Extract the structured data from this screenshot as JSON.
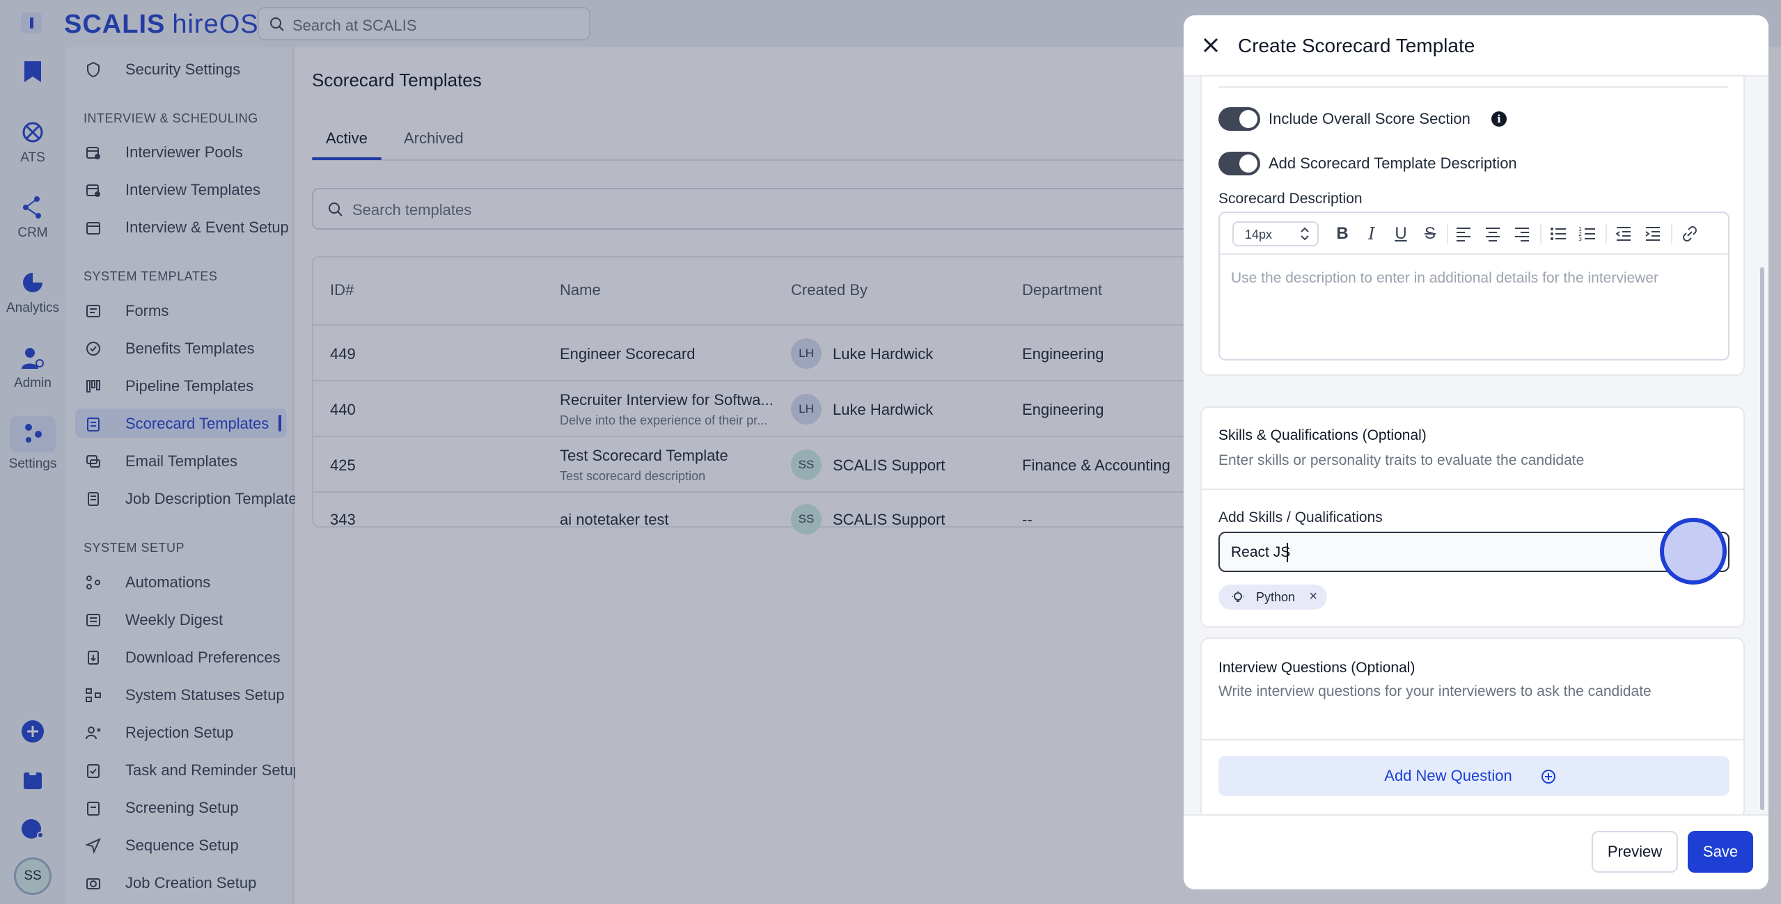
{
  "app": {
    "brand": "SCALIS",
    "product": "hireOS",
    "search_placeholder": "Search at SCALIS"
  },
  "rail": {
    "items": [
      {
        "label": "ATS",
        "icon": "ats-icon"
      },
      {
        "label": "CRM",
        "icon": "crm-icon"
      },
      {
        "label": "Analytics",
        "icon": "analytics-icon"
      },
      {
        "label": "Admin",
        "icon": "admin-icon"
      },
      {
        "label": "Settings",
        "icon": "settings-icon"
      }
    ],
    "avatar": "SS"
  },
  "settings_nav": {
    "top_item": "Security Settings",
    "groups": [
      {
        "heading": "INTERVIEW & SCHEDULING",
        "items": [
          "Interviewer Pools",
          "Interview Templates",
          "Interview & Event Setup"
        ]
      },
      {
        "heading": "SYSTEM TEMPLATES",
        "items": [
          "Forms",
          "Benefits Templates",
          "Pipeline Templates",
          "Scorecard Templates",
          "Email Templates",
          "Job Description Templates"
        ]
      },
      {
        "heading": "SYSTEM SETUP",
        "items": [
          "Automations",
          "Weekly Digest",
          "Download Preferences",
          "System Statuses Setup",
          "Rejection Setup",
          "Task and Reminder Setup",
          "Screening Setup",
          "Sequence Setup",
          "Job Creation Setup"
        ]
      }
    ],
    "active": "Scorecard Templates"
  },
  "main": {
    "title": "Scorecard Templates",
    "tabs": [
      "Active",
      "Archived"
    ],
    "active_tab": "Active",
    "search_placeholder": "Search templates",
    "columns": [
      "ID#",
      "Name",
      "Created By",
      "Department"
    ],
    "rows": [
      {
        "id": "449",
        "name": "Engineer Scorecard",
        "desc": "",
        "initials": "LH",
        "creator": "Luke Hardwick",
        "department": "Engineering"
      },
      {
        "id": "440",
        "name": "Recruiter Interview for Softwa...",
        "desc": "Delve into the experience of their pr...",
        "initials": "LH",
        "creator": "Luke Hardwick",
        "department": "Engineering"
      },
      {
        "id": "425",
        "name": "Test Scorecard Template",
        "desc": "Test scorecard description",
        "initials": "SS",
        "creator": "SCALIS Support",
        "department": "Finance & Accounting"
      },
      {
        "id": "343",
        "name": "ai notetaker test",
        "desc": "",
        "initials": "SS",
        "creator": "SCALIS Support",
        "department": "--"
      }
    ]
  },
  "panel": {
    "title": "Create Scorecard Template",
    "toggle_overall": {
      "label": "Include Overall Score Section",
      "on": true
    },
    "toggle_description": {
      "label": "Add Scorecard Template Description",
      "on": true
    },
    "description_label": "Scorecard Description",
    "font_size": "14px",
    "description_placeholder": "Use the description to enter in additional details for the interviewer",
    "skills": {
      "title": "Skills & Qualifications (Optional)",
      "subtitle": "Enter skills or personality traits to evaluate the candidate",
      "input_label": "Add Skills / Qualifications",
      "input_value": "React JS",
      "chips": [
        "Python"
      ]
    },
    "questions": {
      "title": "Interview Questions (Optional)",
      "subtitle": "Write interview questions for your interviewers to ask the candidate",
      "add_label": "Add New Question"
    },
    "buttons": {
      "preview": "Preview",
      "save": "Save"
    }
  },
  "colors": {
    "accent": "#1d3fd4",
    "brand": "#2547d0"
  }
}
